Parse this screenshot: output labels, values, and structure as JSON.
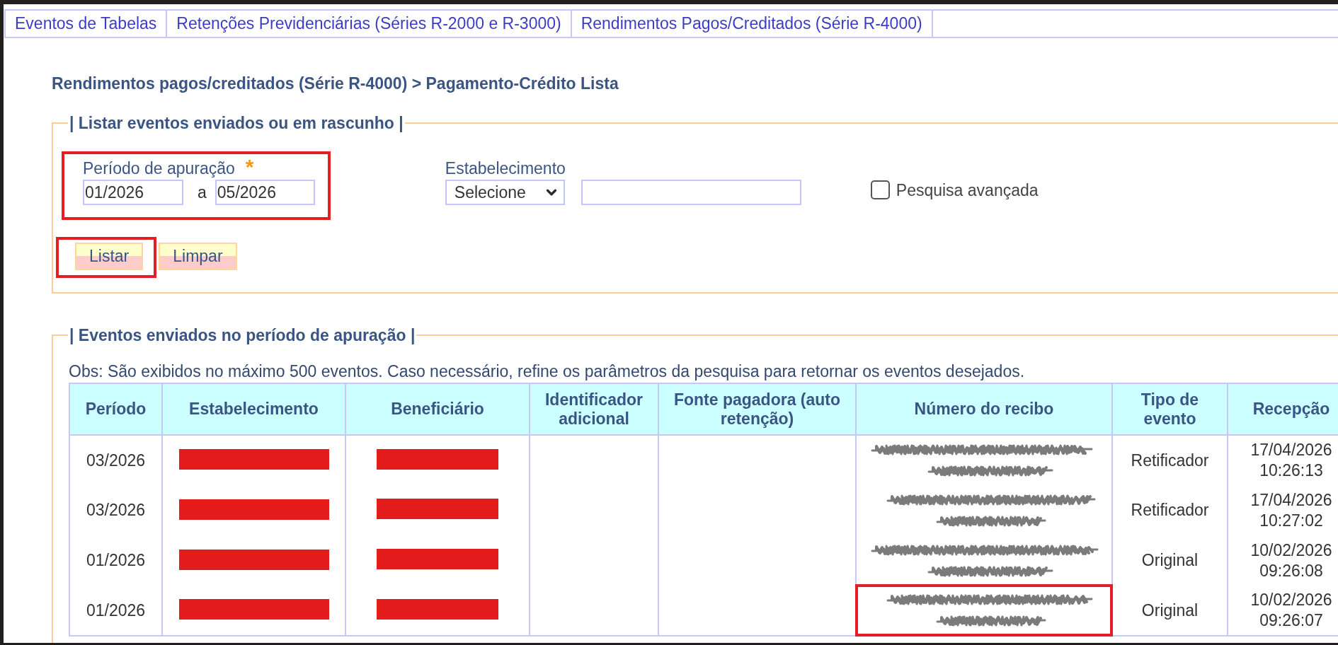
{
  "tabs": [
    {
      "label": "Eventos de Tabelas",
      "selected": false
    },
    {
      "label": "Retenções Previdenciárias (Séries R-2000 e R-3000)",
      "selected": false
    },
    {
      "label": "Rendimentos Pagos/Creditados (Série R-4000)",
      "selected": false
    }
  ],
  "breadcrumb": "Rendimentos pagos/creditados (Série R-4000) > Pagamento-Crédito Lista",
  "filter": {
    "legend": "| Listar eventos enviados ou em rascunho |",
    "period": {
      "label": "Período de apuração",
      "required_mark": "*",
      "from": "01/2026",
      "separator": "a",
      "to": "05/2026",
      "highlighted": true
    },
    "establishment": {
      "label": "Estabelecimento",
      "select": "Selecione"
    },
    "advanced_search": {
      "label": "Pesquisa avançada",
      "checked": false
    },
    "buttons": [
      {
        "label": "Listar",
        "highlighted": true
      },
      {
        "label": "Limpar",
        "highlighted": false
      }
    ]
  },
  "results": {
    "legend": "| Eventos enviados no período de apuração |",
    "note": "Obs: São exibidos no máximo 500 eventos. Caso necessário, refine os parâmetros da pesquisa para retornar os eventos desejados.",
    "table": {
      "columns": [
        "Período",
        "Estabelecimento",
        "Beneficiário",
        "Identificador adicional",
        "Fonte pagadora (auto retenção)",
        "Número do recibo",
        "Tipo de evento",
        "Recepção"
      ],
      "rows": [
        {
          "period": "03/2026",
          "establishment_redacted": true,
          "beneficiary_redacted": true,
          "receipt_obscured": true,
          "receipt_highlighted": false,
          "event_type": "Retificador",
          "received": "17/04/2026 10:26:13"
        },
        {
          "period": "03/2026",
          "establishment_redacted": true,
          "beneficiary_redacted": true,
          "receipt_obscured": true,
          "receipt_highlighted": false,
          "event_type": "Retificador",
          "received": "17/04/2026 10:27:02"
        },
        {
          "period": "01/2026",
          "establishment_redacted": true,
          "beneficiary_redacted": true,
          "receipt_obscured": true,
          "receipt_highlighted": false,
          "event_type": "Original",
          "received": "10/02/2026 09:26:08"
        },
        {
          "period": "01/2026",
          "establishment_redacted": true,
          "beneficiary_redacted": true,
          "receipt_obscured": true,
          "receipt_highlighted": true,
          "event_type": "Original",
          "received": "10/02/2026 09:26:07"
        }
      ]
    }
  }
}
